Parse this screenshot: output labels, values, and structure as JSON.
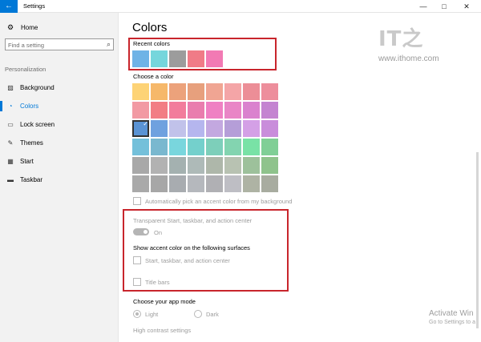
{
  "window": {
    "title": "Settings",
    "back_icon": "←",
    "minimize_icon": "—",
    "maximize_icon": "□",
    "close_icon": "✕"
  },
  "sidebar": {
    "home_icon": "⚙",
    "home_label": "Home",
    "search_placeholder": "Find a setting",
    "search_icon": "⌕",
    "section_label": "Personalization",
    "items": [
      {
        "label": "Background",
        "icon": "▨",
        "icon_name": "background-icon"
      },
      {
        "label": "Colors",
        "icon": "◔",
        "icon_name": "colors-icon",
        "active": true
      },
      {
        "label": "Lock screen",
        "icon": "▭",
        "icon_name": "lock-screen-icon"
      },
      {
        "label": "Themes",
        "icon": "✎",
        "icon_name": "themes-icon"
      },
      {
        "label": "Start",
        "icon": "▦",
        "icon_name": "start-icon"
      },
      {
        "label": "Taskbar",
        "icon": "▬",
        "icon_name": "taskbar-icon"
      }
    ]
  },
  "main": {
    "title": "Colors",
    "recent_colors_label": "Recent colors",
    "recent_colors": [
      "#6fb3e6",
      "#76d6dc",
      "#9c9c9c",
      "#f07b87",
      "#f27ab4"
    ],
    "choose_color_label": "Choose a color",
    "palette": [
      [
        "#fdd376",
        "#f6b86a",
        "#eca27b",
        "#e7a07d",
        "#f0a593",
        "#f4a5a7",
        "#ec8e97",
        "#ed8e9c"
      ],
      [
        "#f29aa3",
        "#f27d84",
        "#f27c9c",
        "#e97dae",
        "#ef80c3",
        "#e985c6",
        "#da82ce",
        "#c484d1"
      ],
      [
        "#5a93d4",
        "#6fa1df",
        "#c1c2ea",
        "#b5b6ee",
        "#c3a8e0",
        "#b59ed8",
        "#d4a0e6",
        "#c98ddb"
      ],
      [
        "#74c0da",
        "#7ab8cf",
        "#79d6dd",
        "#74d0cc",
        "#7dcfba",
        "#83d4b0",
        "#79e2a6",
        "#80cf96"
      ],
      [
        "#a8a8a8",
        "#b2b2b2",
        "#a4b1b0",
        "#aebab8",
        "#aeb7aa",
        "#b8c2b2",
        "#9dc19b",
        "#8fc38c"
      ],
      [
        "#a9a9a9",
        "#a7a7a7",
        "#a8acb0",
        "#b5b8bd",
        "#b0b0b4",
        "#bebec4",
        "#aeb3a4",
        "#a8aca0"
      ]
    ],
    "selected_swatch_check": "✓",
    "auto_accent_label": "Automatically pick an accent color from my background",
    "transparent_label": "Transparent Start, taskbar, and action center",
    "toggle_state": "On",
    "show_accent_label": "Show accent color on the following surfaces",
    "start_taskbar_label": "Start, taskbar, and action center",
    "title_bars_label": "Title bars",
    "app_mode_label": "Choose your app mode",
    "light_label": "Light",
    "dark_label": "Dark",
    "high_contrast_label": "High contrast settings",
    "highlight_color": "#c8252c"
  },
  "watermark": {
    "logo_text": "IT之",
    "url_text": "www.ithome.com"
  },
  "activation": {
    "title": "Activate Win",
    "subtitle": "Go to Settings to a"
  }
}
